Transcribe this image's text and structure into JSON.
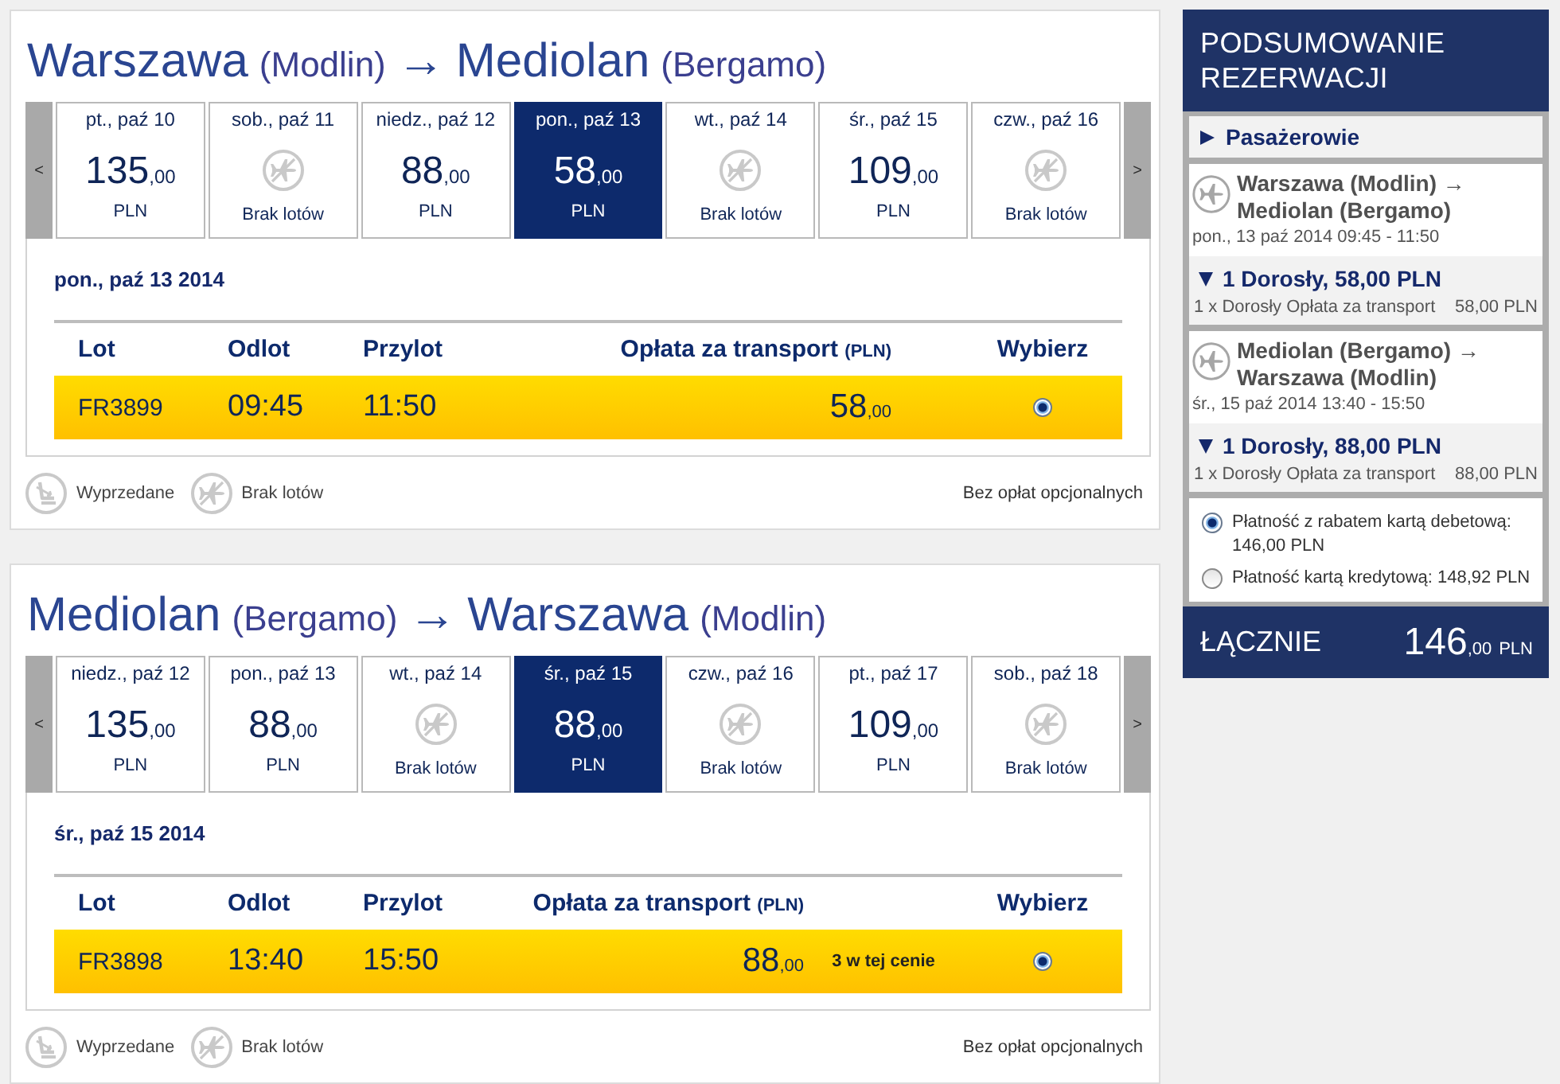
{
  "journeys": [
    {
      "title": {
        "origin": "Warszawa",
        "origin_airport": "(Modlin)",
        "arrow": "→",
        "destination": "Mediolan",
        "destination_airport": "(Bergamo)"
      },
      "previous_button": "<",
      "next_button": ">",
      "dates": [
        {
          "date": "pt., paź 10",
          "kind": "fare",
          "price": "135",
          "cents": ",00",
          "currency": "PLN",
          "selected": false
        },
        {
          "date": "sob., paź 11",
          "kind": "no_flights",
          "label": "Brak lotów",
          "selected": false
        },
        {
          "date": "niedz., paź 12",
          "kind": "fare",
          "price": "88",
          "cents": ",00",
          "currency": "PLN",
          "selected": false
        },
        {
          "date": "pon., paź 13",
          "kind": "fare",
          "price": "58",
          "cents": ",00",
          "currency": "PLN",
          "selected": true
        },
        {
          "date": "wt., paź 14",
          "kind": "no_flights",
          "label": "Brak lotów",
          "selected": false
        },
        {
          "date": "śr., paź 15",
          "kind": "fare",
          "price": "109",
          "cents": ",00",
          "currency": "PLN",
          "selected": false
        },
        {
          "date": "czw., paź 16",
          "kind": "no_flights",
          "label": "Brak lotów",
          "selected": false
        }
      ],
      "day_heading": "pon., paź 13 2014",
      "table": {
        "columns": [
          {
            "kind": "flight",
            "label": "Lot"
          },
          {
            "kind": "departure",
            "label": "Odlot"
          },
          {
            "kind": "arrival",
            "label": "Przylot"
          },
          {
            "kind": "price",
            "label": "Opłata za transport",
            "unit": "(PLN)"
          },
          {
            "kind": "select",
            "label": "Wybierz"
          }
        ],
        "rows": [
          {
            "flight": "FR3899",
            "departure": "09:45",
            "arrival": "11:50",
            "price": "58",
            "cents": ",00",
            "selected": true
          }
        ]
      },
      "legend": [
        {
          "kind": "sold_out",
          "label": "Wyprzedane"
        },
        {
          "kind": "no_flights",
          "label": "Brak lotów"
        }
      ],
      "fees_note": "Bez opłat opcjonalnych"
    },
    {
      "title": {
        "origin": "Mediolan",
        "origin_airport": "(Bergamo)",
        "arrow": "→",
        "destination": "Warszawa",
        "destination_airport": "(Modlin)"
      },
      "previous_button": "<",
      "next_button": ">",
      "dates": [
        {
          "date": "niedz., paź 12",
          "kind": "fare",
          "price": "135",
          "cents": ",00",
          "currency": "PLN",
          "selected": false
        },
        {
          "date": "pon., paź 13",
          "kind": "fare",
          "price": "88",
          "cents": ",00",
          "currency": "PLN",
          "selected": false
        },
        {
          "date": "wt., paź 14",
          "kind": "no_flights",
          "label": "Brak lotów",
          "selected": false
        },
        {
          "date": "śr., paź 15",
          "kind": "fare",
          "price": "88",
          "cents": ",00",
          "currency": "PLN",
          "selected": true
        },
        {
          "date": "czw., paź 16",
          "kind": "no_flights",
          "label": "Brak lotów",
          "selected": false
        },
        {
          "date": "pt., paź 17",
          "kind": "fare",
          "price": "109",
          "cents": ",00",
          "currency": "PLN",
          "selected": false
        },
        {
          "date": "sob., paź 18",
          "kind": "no_flights",
          "label": "Brak lotów",
          "selected": false
        }
      ],
      "day_heading": "śr., paź 15 2014",
      "table": {
        "columns": [
          {
            "kind": "flight",
            "label": "Lot"
          },
          {
            "kind": "departure",
            "label": "Odlot"
          },
          {
            "kind": "arrival",
            "label": "Przylot"
          },
          {
            "kind": "price",
            "label": "Opłata za transport",
            "unit": "(PLN)"
          },
          {
            "kind": "select",
            "label": "Wybierz"
          }
        ],
        "rows": [
          {
            "flight": "FR3898",
            "departure": "13:40",
            "arrival": "15:50",
            "price": "88",
            "cents": ",00",
            "note": "3 w tej cenie",
            "selected": true
          }
        ]
      },
      "legend": [
        {
          "kind": "sold_out",
          "label": "Wyprzedane"
        },
        {
          "kind": "no_flights",
          "label": "Brak lotów"
        }
      ],
      "fees_note": "Bez opłat opcjonalnych"
    }
  ],
  "summary": {
    "title": "PODSUMOWANIE REZERWACJI",
    "passengers": {
      "label": "Pasażerowie",
      "expanded": false
    },
    "flights": [
      {
        "route": "Warszawa (Modlin) → Mediolan (Bergamo)",
        "schedule": "pon., 13 paź 2014 09:45 - 11:50",
        "fare": {
          "label": "1 Dorosły, 58,00 PLN",
          "expanded": true,
          "item": "1 x Dorosły Opłata za transport",
          "amount": "58,00 PLN"
        }
      },
      {
        "route": "Mediolan (Bergamo) → Warszawa (Modlin)",
        "schedule": "śr., 15 paź 2014 13:40 - 15:50",
        "fare": {
          "label": "1 Dorosły, 88,00 PLN",
          "expanded": true,
          "item": "1 x Dorosły Opłata za transport",
          "amount": "88,00 PLN"
        }
      }
    ],
    "payment_options": [
      {
        "label": "Płatność z rabatem kartą debetową: 146,00 PLN",
        "selected": true
      },
      {
        "label": "Płatność kartą kredytową: 148,92 PLN",
        "selected": false
      }
    ],
    "total": {
      "label": "ŁĄCZNIE",
      "amount": "146",
      "cents": ",00",
      "currency": "PLN"
    }
  }
}
